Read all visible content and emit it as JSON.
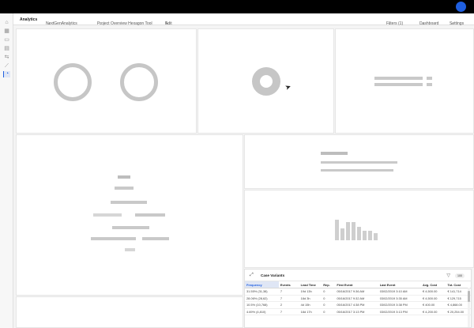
{
  "toolbar": {
    "title": "Analytics",
    "workspace": "NextGenAnalytics",
    "project": "Project Overview Hexagon Tool",
    "edit_label": "Edit",
    "filters_label": "Filters (1)",
    "dashboard_label": "Dashboard",
    "settings_label": "Settings"
  },
  "icons": {
    "edit": "pencil-icon",
    "chevron": "chevron-down-icon",
    "expand": "expand-icon",
    "filter": "filter-icon"
  },
  "colors": {
    "accent": "#1f5fe0",
    "placeholder": "#c6c6c6",
    "topbar": "#000000"
  },
  "case_variants": {
    "title": "Case Variants",
    "count": "100",
    "columns": [
      "Frequency",
      "Events",
      "Lead Time",
      "Rep.",
      "First Event",
      "Last Event",
      "Avg. Cost",
      "Tot. Cost"
    ],
    "rows": [
      [
        "31.55% (31,38)",
        "7",
        "19d 13h",
        "0",
        "05/16/2017 9:36 AM",
        "03/02/2019 3:10 AM",
        "€ 4,500.00",
        "€ 141,714"
      ],
      [
        "28.06% (28,62)",
        "7",
        "18d 3h",
        "0",
        "05/16/2017 9:32 AM",
        "03/02/2019 3:35 AM",
        "€ 4,500.00",
        "€ 129,715"
      ],
      [
        "10.5% (10,768)",
        "2",
        "4d 15h",
        "0",
        "05/16/2017 4:38 PM",
        "03/02/2019 3:38 PM",
        "€ 400.00",
        "€ 4,868.00"
      ],
      [
        "4.69% (4,810)",
        "7",
        "18d 17h",
        "0",
        "05/16/2017 3:13 PM",
        "03/02/2019 3:13 PM",
        "€ 4,200.00",
        "€ 20,254.00"
      ]
    ]
  }
}
